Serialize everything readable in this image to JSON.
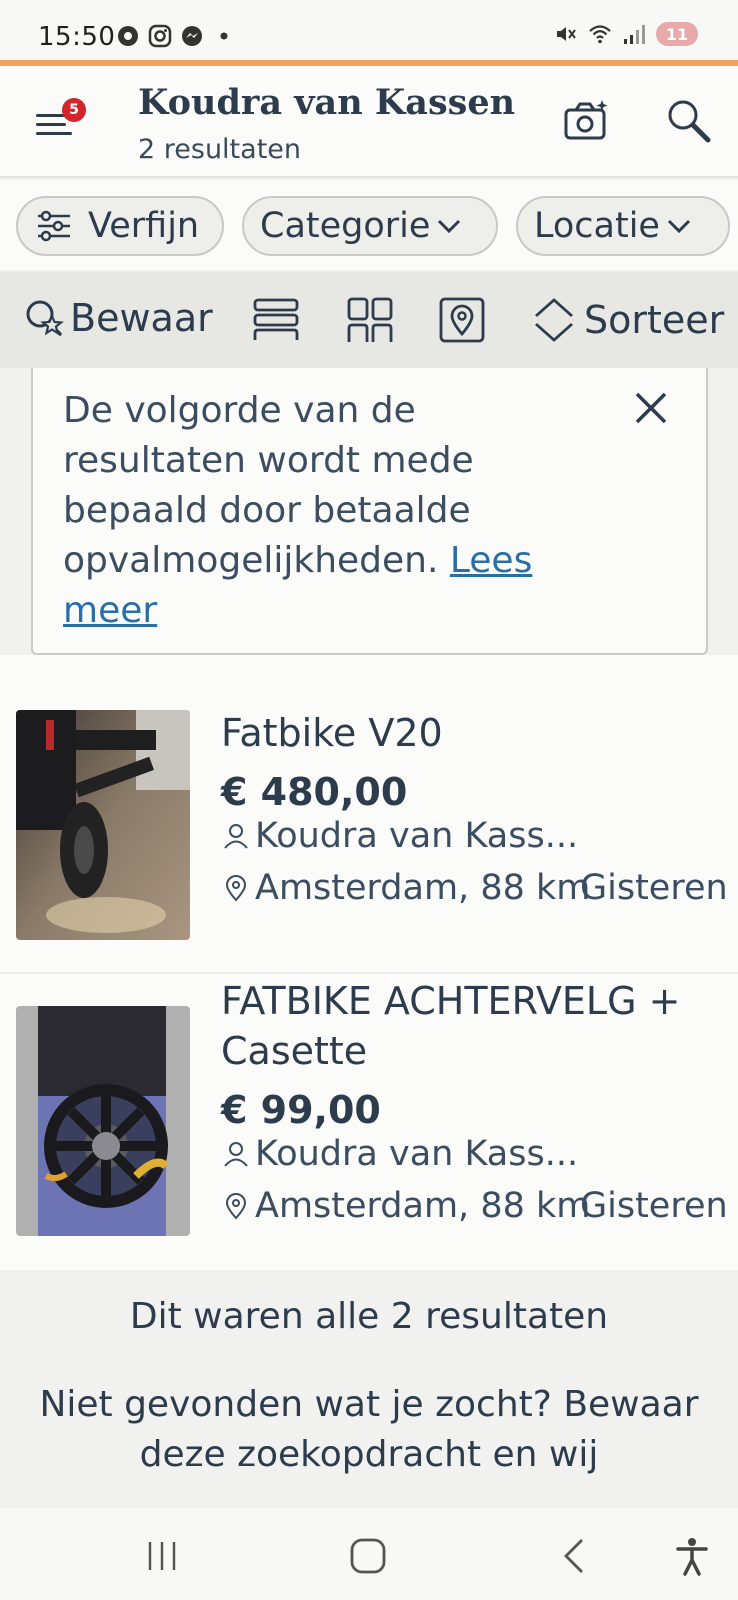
{
  "status": {
    "time": "15:50",
    "battery": "11"
  },
  "header": {
    "title": "Koudra van Kassen",
    "subtitle": "2 resultaten",
    "menu_badge": "5"
  },
  "filters": {
    "verfijn": "Verfijn",
    "categorie": "Categorie",
    "locatie": "Locatie"
  },
  "toolbar": {
    "bewaar": "Bewaar",
    "sorteer": "Sorteer"
  },
  "notice": {
    "text": "De volgorde van de resultaten wordt mede bepaald door betaalde opvalmogelijkheden. ",
    "link": "Lees meer"
  },
  "listings": [
    {
      "title": "Fatbike V20",
      "price": "€ 480,00",
      "seller": "Koudra van Kass...",
      "location": "Amsterdam, 88 km",
      "date": "Gisteren"
    },
    {
      "title": "FATBIKE ACHTERVELG + Casette",
      "price": "€ 99,00",
      "seller": "Koudra van Kass...",
      "location": "Amsterdam, 88 km",
      "date": "Gisteren"
    }
  ],
  "footer": {
    "end_text": "Dit waren alle 2 resultaten",
    "question": "Niet gevonden wat je zocht? Bewaar deze zoekopdracht en wij"
  },
  "colors": {
    "accent": "#f0a25f",
    "text": "#2d3c4d",
    "link": "#2a6ea6",
    "badge": "#d1242b"
  }
}
